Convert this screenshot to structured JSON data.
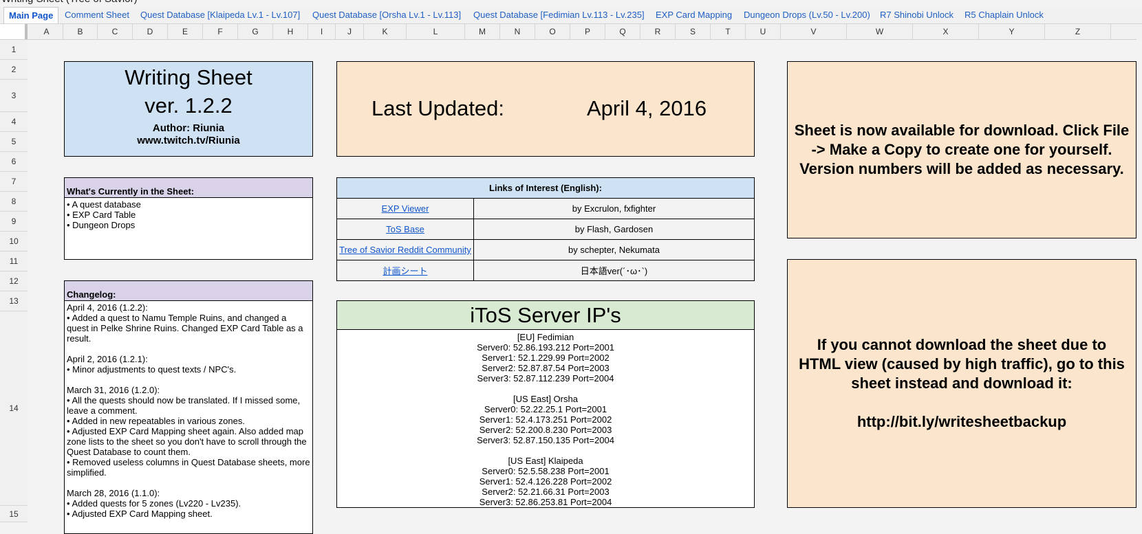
{
  "document": {
    "title": "Writing Sheet (Tree of Savior)"
  },
  "tabs": [
    {
      "label": "Main Page",
      "active": true
    },
    {
      "label": "Comment Sheet"
    },
    {
      "label": "Quest Database [Klaipeda Lv.1 - Lv.107]"
    },
    {
      "label": "Quest Database [Orsha Lv.1 - Lv.113]"
    },
    {
      "label": "Quest Database [Fedimian Lv.113 - Lv.235]"
    },
    {
      "label": "EXP Card Mapping"
    },
    {
      "label": "Dungeon Drops (Lv.50 - Lv.200)"
    },
    {
      "label": "R7 Shinobi Unlock"
    },
    {
      "label": "R5 Chaplain Unlock"
    }
  ],
  "columns": [
    "A",
    "B",
    "C",
    "D",
    "E",
    "F",
    "G",
    "H",
    "I",
    "J",
    "K",
    "L",
    "M",
    "N",
    "O",
    "P",
    "Q",
    "R",
    "S",
    "T",
    "U",
    "V",
    "W",
    "X",
    "Y",
    "Z"
  ],
  "rows": [
    "1",
    "2",
    "3",
    "4",
    "5",
    "6",
    "7",
    "8",
    "9",
    "10",
    "11",
    "12",
    "13",
    "14",
    "15"
  ],
  "header_box": {
    "title_line1": "Writing Sheet",
    "title_line2": "ver. 1.2.2",
    "author": "Author: Riunia",
    "link": "www.twitch.tv/Riunia"
  },
  "last_updated": {
    "label": "Last Updated:",
    "value": "April 4, 2016"
  },
  "notices": {
    "download": "Sheet is now available for download. Click File -> Make a Copy to create one for yourself. Version numbers will be added as necessary.",
    "backup_text": "If you cannot download the sheet due to HTML view (caused by high traffic), go to this sheet instead and download it:",
    "backup_url": "http://bit.ly/writesheetbackup"
  },
  "current_contents": {
    "heading": "What's Currently in the Sheet:",
    "items": [
      "• A quest database",
      "• EXP Card Table",
      "• Dungeon Drops"
    ]
  },
  "changelog": {
    "heading": "Changelog:",
    "entries": [
      {
        "date": "April 4, 2016 (1.2.2):",
        "items": [
          "• Added a quest to Namu Temple Ruins, and changed a quest in Pelke Shrine Ruins. Changed EXP Card Table as a result."
        ]
      },
      {
        "date": "April 2, 2016 (1.2.1):",
        "items": [
          "• Minor adjustments to quest texts / NPC's."
        ]
      },
      {
        "date": "March 31, 2016 (1.2.0):",
        "items": [
          "• All the quests should now be translated. If I missed some, leave a comment.",
          "• Added in new repeatables in various zones.",
          "• Adjusted EXP Card Mapping sheet again. Also added map zone lists to the sheet so you don't have to scroll through the Quest Database to count them.",
          "• Removed useless columns in Quest Database sheets, more simplified."
        ]
      },
      {
        "date": "March 28, 2016 (1.1.0):",
        "items": [
          "• Added quests for 5 zones (Lv220 - Lv235).",
          "• Adjusted EXP Card Mapping sheet."
        ]
      }
    ]
  },
  "links": {
    "heading": "Links of Interest (English):",
    "rows": [
      {
        "name": "EXP Viewer",
        "credit": "by Excrulon, fxfighter"
      },
      {
        "name": "ToS Base",
        "credit": "by Flash, Gardosen"
      },
      {
        "name": "Tree of Savior Reddit Community",
        "credit": "by schepter, Nekumata"
      },
      {
        "name": "計画シート",
        "credit": "日本語ver(´･ω･`)"
      }
    ]
  },
  "servers": {
    "heading": "iToS Server IP's",
    "groups": [
      {
        "name": "[EU] Fedimian",
        "lines": [
          "Server0: 52.86.193.212 Port=2001",
          "Server1: 52.1.229.99 Port=2002",
          "Server2: 52.87.87.54 Port=2003",
          "Server3: 52.87.112.239 Port=2004"
        ]
      },
      {
        "name": "[US East] Orsha",
        "lines": [
          "Server0: 52.22.25.1 Port=2001",
          "Server1: 52.4.173.251 Port=2002",
          "Server2: 52.200.8.230 Port=2003",
          "Server3: 52.87.150.135 Port=2004"
        ]
      },
      {
        "name": "[US East] Klaipeda",
        "lines": [
          "Server0: 52.5.58.238 Port=2001",
          "Server1: 52.4.126.228 Port=2002",
          "Server2: 52.21.66.31 Port=2003",
          "Server3: 52.86.253.81 Port=2004"
        ]
      }
    ]
  }
}
